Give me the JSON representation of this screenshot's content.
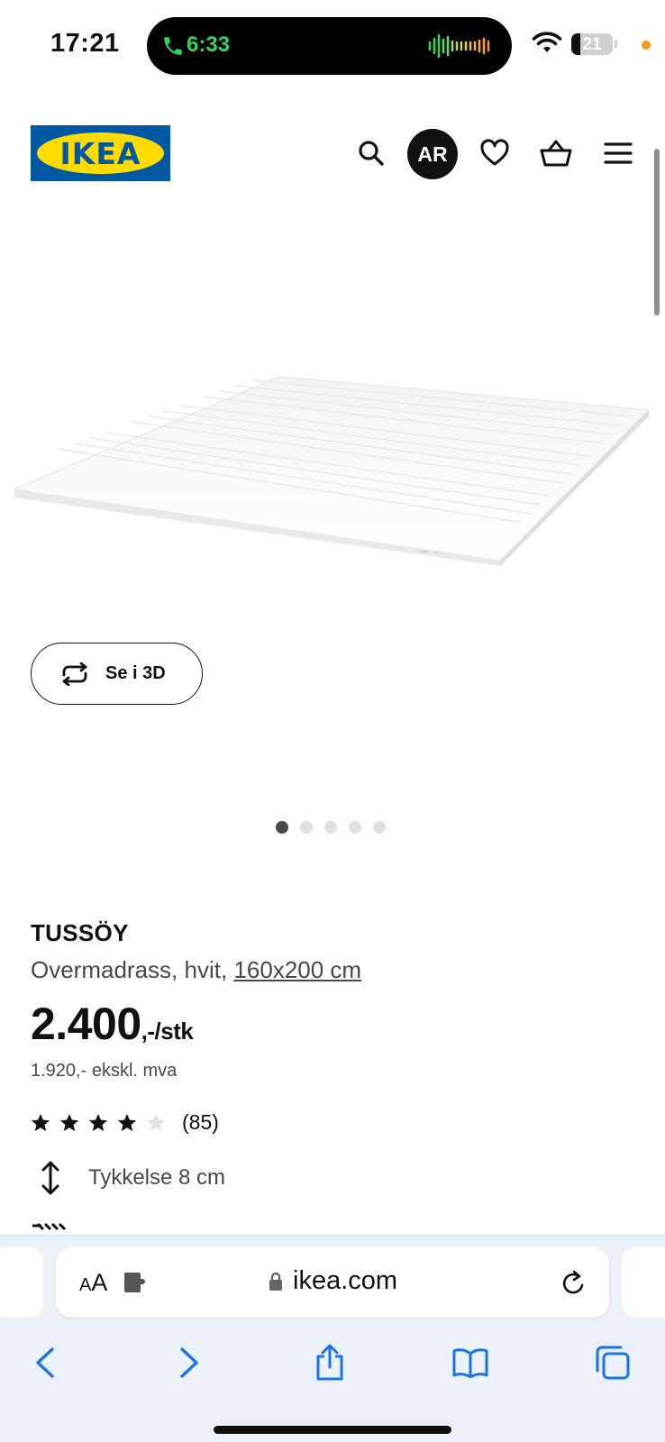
{
  "status_bar": {
    "time": "17:21",
    "call_time": "6:33",
    "battery": "21",
    "battery_level_percent": 21
  },
  "header": {
    "logo_text": "IKEA",
    "ar_label": "AR",
    "icons": [
      "search-icon",
      "heart-icon",
      "basket-icon",
      "menu-icon"
    ]
  },
  "gallery": {
    "view_3d_label": "Se i 3D",
    "slide_count": 5,
    "active_slide": 1
  },
  "product": {
    "name": "TUSSÖY",
    "description": "Overmadrass, hvit, ",
    "size_link": "160x200 cm",
    "price_main": "2.400",
    "price_suffix": ",-/stk",
    "price_ex_vat": "1.920,- ekskl. mva",
    "rating_stars": 4,
    "rating_max": 5,
    "review_count": "(85)",
    "thickness": "Tykkelse 8 cm"
  },
  "browser": {
    "text_size_label": "AA",
    "domain": "ikea.com"
  },
  "colors": {
    "ikea_blue": "#0058a3",
    "ikea_yellow": "#ffdb00",
    "ios_blue": "#1a73e8",
    "call_green": "#33d35b"
  }
}
